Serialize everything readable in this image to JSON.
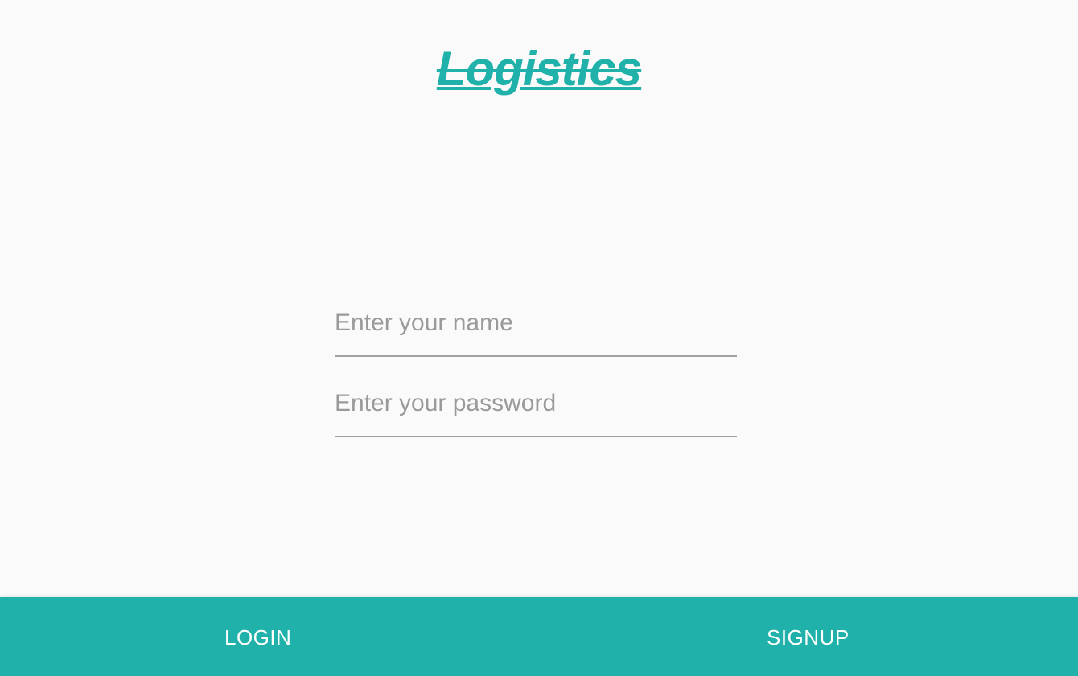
{
  "logo": {
    "text": "Logistics"
  },
  "form": {
    "name_placeholder": "Enter your name",
    "name_value": "",
    "password_placeholder": "Enter your password",
    "password_value": ""
  },
  "bottom_nav": {
    "login_label": "LOGIN",
    "signup_label": "SIGNUP"
  },
  "colors": {
    "accent": "#20b2aa",
    "background": "#fafafa",
    "placeholder": "#9a9a9a",
    "underline": "#a0a0a0"
  }
}
